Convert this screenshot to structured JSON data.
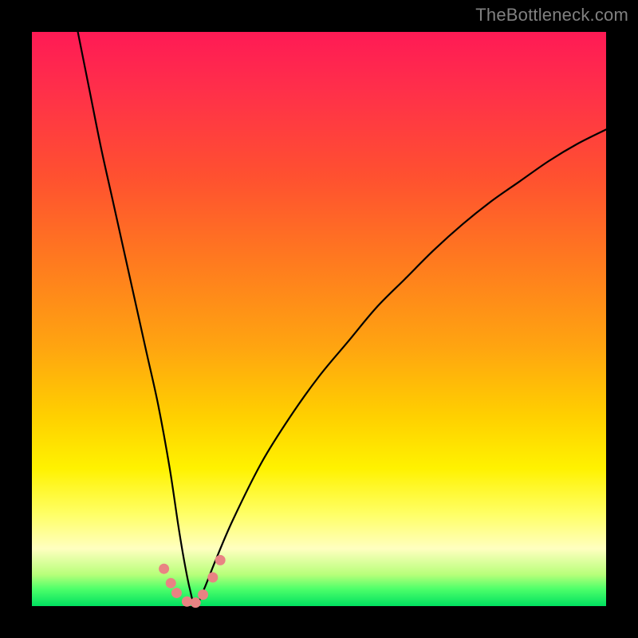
{
  "watermark": {
    "text": "TheBottleneck.com"
  },
  "chart_data": {
    "type": "line",
    "title": "",
    "xlabel": "",
    "ylabel": "",
    "xlim": [
      0,
      100
    ],
    "ylim": [
      0,
      100
    ],
    "series": [
      {
        "name": "bottleneck-curve",
        "x": [
          8,
          10,
          12,
          14,
          16,
          18,
          20,
          22,
          24,
          25.5,
          26.5,
          27.5,
          28.5,
          30,
          32,
          35,
          40,
          45,
          50,
          55,
          60,
          65,
          70,
          75,
          80,
          85,
          90,
          95,
          100
        ],
        "values": [
          100,
          90,
          80,
          71,
          62,
          53,
          44,
          35,
          24,
          14,
          8,
          3,
          0,
          3,
          8,
          15,
          25,
          33,
          40,
          46,
          52,
          57,
          62,
          66.5,
          70.5,
          74,
          77.5,
          80.5,
          83
        ]
      }
    ],
    "markers": {
      "name": "near-minimum-dots",
      "x": [
        23.0,
        24.2,
        25.2,
        27.0,
        28.5,
        29.8,
        31.5,
        32.8
      ],
      "values": [
        6.5,
        4.0,
        2.3,
        0.8,
        0.6,
        2.0,
        5.0,
        8.0
      ]
    },
    "background_gradient": {
      "top": "#ff1a55",
      "mid_upper": "#ff7a1f",
      "mid": "#fff200",
      "lower": "#ffffc0",
      "bottom": "#00e060"
    }
  }
}
